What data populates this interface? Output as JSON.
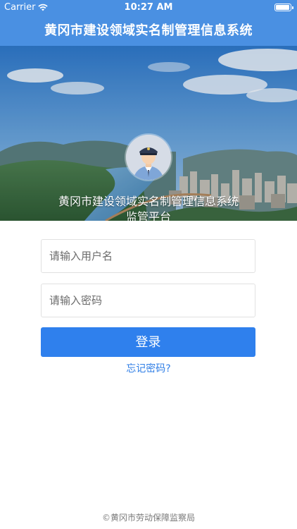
{
  "status_bar": {
    "carrier": "Carrier",
    "time": "10:27 AM",
    "icons": [
      "wifi-icon",
      "battery-icon"
    ]
  },
  "nav": {
    "title": "黄冈市建设领域实名制管理信息系统"
  },
  "hero": {
    "title_line1": "黄冈市建设领域实名制管理信息系统",
    "title_line2": "监管平台",
    "avatar_icon": "police-officer-avatar-icon"
  },
  "form": {
    "username_placeholder": "请输入用户名",
    "password_placeholder": "请输入密码",
    "login_label": "登录",
    "forgot_label": "忘记密码?"
  },
  "footer": {
    "text": "©黄冈市劳动保障监察局"
  },
  "colors": {
    "nav_bg": "#4a90e2",
    "button_bg": "#2f80ed",
    "link": "#2f7ee6"
  }
}
